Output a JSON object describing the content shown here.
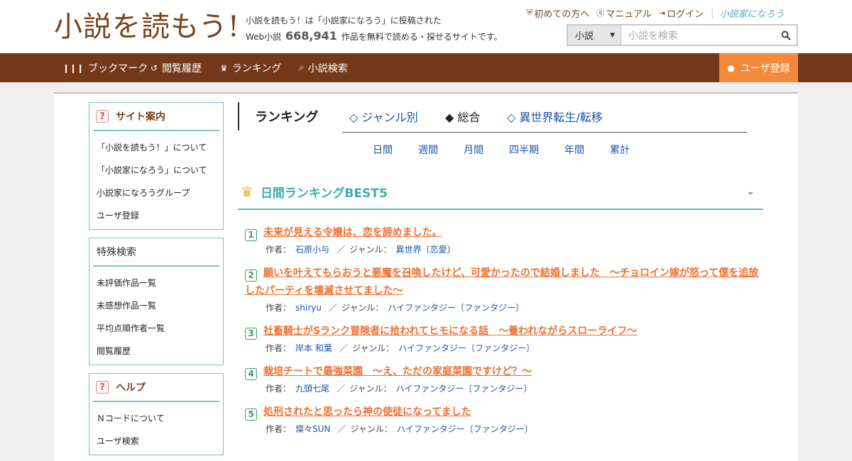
{
  "header": {
    "logo_text": "小説を読もう!",
    "tagline_line1": "小説を読もう！は「小説家になろう」に投稿された",
    "tagline_pre": "Web小説",
    "tagline_count": "668,941",
    "tagline_post": "作品を無料で読める・探せるサイトです。",
    "top_links": [
      {
        "label": "初めての方へ",
        "icon": "shield-icon"
      },
      {
        "label": "マニュアル",
        "icon": "question-circle-icon"
      },
      {
        "label": "ログイン",
        "icon": "login-icon"
      }
    ],
    "brand_mini": "小説家になろう",
    "search": {
      "select_value": "小説",
      "placeholder": "小説を検索"
    }
  },
  "nav": {
    "items": [
      {
        "label": "ブックマーク",
        "icon": "bookmark-icon"
      },
      {
        "label": "閲覧履歴",
        "icon": "history-icon"
      },
      {
        "label": "ランキング",
        "icon": "crown-icon"
      },
      {
        "label": "小説検索",
        "icon": "search-icon"
      }
    ],
    "register": "ユーザ登録"
  },
  "sidebar": {
    "site_guide": {
      "title": "サイト案内",
      "items": [
        "「小説を読もう！」について",
        "「小説家になろう」について",
        "小説家になろうグループ",
        "ユーザ登録"
      ]
    },
    "special_search": {
      "title": "特殊検索",
      "items": [
        "未評価作品一覧",
        "未感想作品一覧",
        "平均点順作者一覧",
        "閲覧履歴"
      ]
    },
    "help": {
      "title": "ヘルプ",
      "items": [
        "Ｎコードについて",
        "ユーザ検索"
      ]
    }
  },
  "ranking": {
    "heading": "ランキング",
    "tabs": [
      "◇ ジャンル別",
      "◆ 総合",
      "◇ 異世界転生/転移"
    ],
    "active_tab": "◆ 総合",
    "periods": [
      "日間",
      "週間",
      "月間",
      "四半期",
      "年間",
      "累計"
    ],
    "best_title": "日間ランキングBEST5",
    "author_label": "作者：",
    "genre_label": "ジャンル：",
    "slash": "／",
    "items": [
      {
        "rank": "1",
        "title": "未来が見える令嬢は、恋を諦めました。",
        "author": "石原小与",
        "genre": "異世界〔恋愛〕"
      },
      {
        "rank": "2",
        "title": "願いを叶えてもらおうと悪魔を召喚したけど、可愛かったので結婚しました　～チョロイン嫁が怒って僕を追放したパーティを壊滅させてました～",
        "author": "shiryu",
        "genre": "ハイファンタジー〔ファンタジー〕"
      },
      {
        "rank": "3",
        "title": "社畜騎士がSランク冒険者に拾われてヒモになる話　～養われながらスローライフ～",
        "author": "岸本 和葉",
        "genre": "ハイファンタジー〔ファンタジー〕"
      },
      {
        "rank": "4",
        "title": "栽培チートで最強菜園　～え、ただの家庭菜園ですけど？～",
        "author": "九頭七尾",
        "genre": "ハイファンタジー〔ファンタジー〕"
      },
      {
        "rank": "5",
        "title": "処刑されたと思ったら神の使徒になってました",
        "author": "燦々SUN",
        "genre": "ハイファンタジー〔ファンタジー〕"
      }
    ]
  },
  "colors": {
    "nav_bg": "#74381a",
    "register_bg": "#f5893a",
    "accent_teal": "#3fadad",
    "title_orange": "#f07030",
    "link_blue": "#1a55a8"
  }
}
